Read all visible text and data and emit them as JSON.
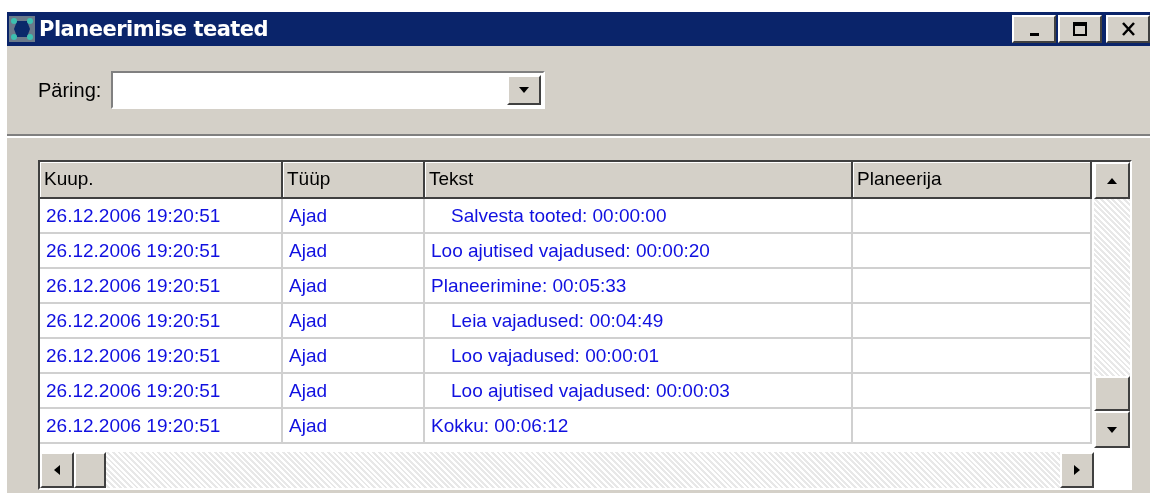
{
  "window": {
    "title": "Planeerimise teated"
  },
  "query": {
    "label": "Päring:"
  },
  "table": {
    "columns": [
      "Kuup.",
      "Tüüp",
      "Tekst",
      "Planeerija"
    ],
    "rows": [
      {
        "date": "26.12.2006 19:20:51",
        "type": "Ajad",
        "text": "Salvesta tooted: 00:00:00",
        "indented": true
      },
      {
        "date": "26.12.2006 19:20:51",
        "type": "Ajad",
        "text": "Loo ajutised vajadused: 00:00:20",
        "indented": false
      },
      {
        "date": "26.12.2006 19:20:51",
        "type": "Ajad",
        "text": "Planeerimine: 00:05:33",
        "indented": false
      },
      {
        "date": "26.12.2006 19:20:51",
        "type": "Ajad",
        "text": "Leia vajadused: 00:04:49",
        "indented": true
      },
      {
        "date": "26.12.2006 19:20:51",
        "type": "Ajad",
        "text": "Loo vajadused: 00:00:01",
        "indented": true
      },
      {
        "date": "26.12.2006 19:20:51",
        "type": "Ajad",
        "text": "Loo ajutised vajadused: 00:00:03",
        "indented": true
      },
      {
        "date": "26.12.2006 19:20:51",
        "type": "Ajad",
        "text": "Kokku: 00:06:12",
        "indented": false
      }
    ]
  }
}
